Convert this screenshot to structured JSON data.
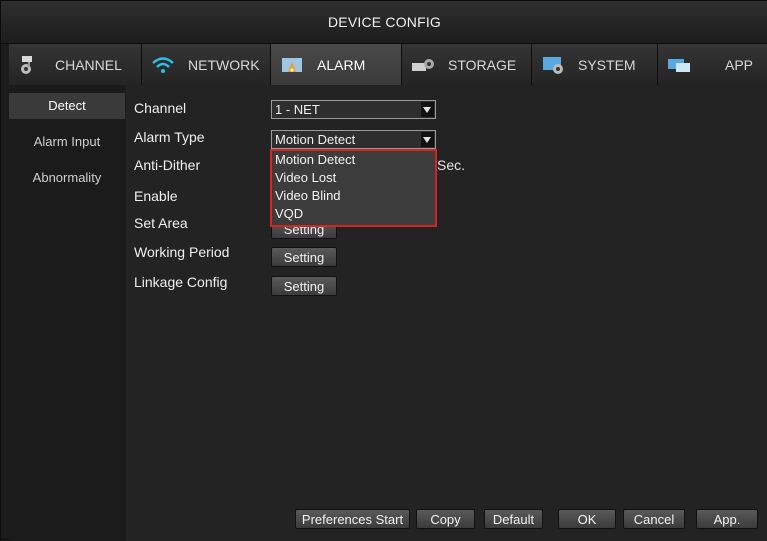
{
  "window": {
    "title": "DEVICE CONFIG"
  },
  "tabs": [
    {
      "label": "CHANNEL",
      "icon": "camera-icon",
      "active": false
    },
    {
      "label": "NETWORK",
      "icon": "wifi-icon",
      "active": false
    },
    {
      "label": "ALARM",
      "icon": "alarm-icon",
      "active": true
    },
    {
      "label": "STORAGE",
      "icon": "storage-icon",
      "active": false
    },
    {
      "label": "SYSTEM",
      "icon": "system-icon",
      "active": false
    },
    {
      "label": "APP",
      "icon": "app-icon",
      "active": false
    }
  ],
  "sidebar": {
    "items": [
      {
        "label": "Detect",
        "active": true
      },
      {
        "label": "Alarm Input",
        "active": false
      },
      {
        "label": "Abnormality",
        "active": false
      }
    ]
  },
  "form": {
    "channel": {
      "label": "Channel",
      "value": "1 - NET"
    },
    "alarm_type": {
      "label": "Alarm Type",
      "value": "Motion Detect"
    },
    "anti_dither": {
      "label": "Anti-Dither",
      "unit": "Sec."
    },
    "enable": {
      "label": "Enable"
    },
    "set_area": {
      "label": "Set Area",
      "button": "Setting"
    },
    "working_period": {
      "label": "Working Period",
      "button": "Setting"
    },
    "linkage_config": {
      "label": "Linkage Config",
      "button": "Setting"
    }
  },
  "dropdown": {
    "options": [
      "Motion Detect",
      "Video Lost",
      "Video Blind",
      "VQD"
    ],
    "highlight_color": "#d42424"
  },
  "footer": {
    "preferences_start": "Preferences Start",
    "copy": "Copy",
    "default": "Default",
    "ok": "OK",
    "cancel": "Cancel",
    "apply": "App."
  }
}
